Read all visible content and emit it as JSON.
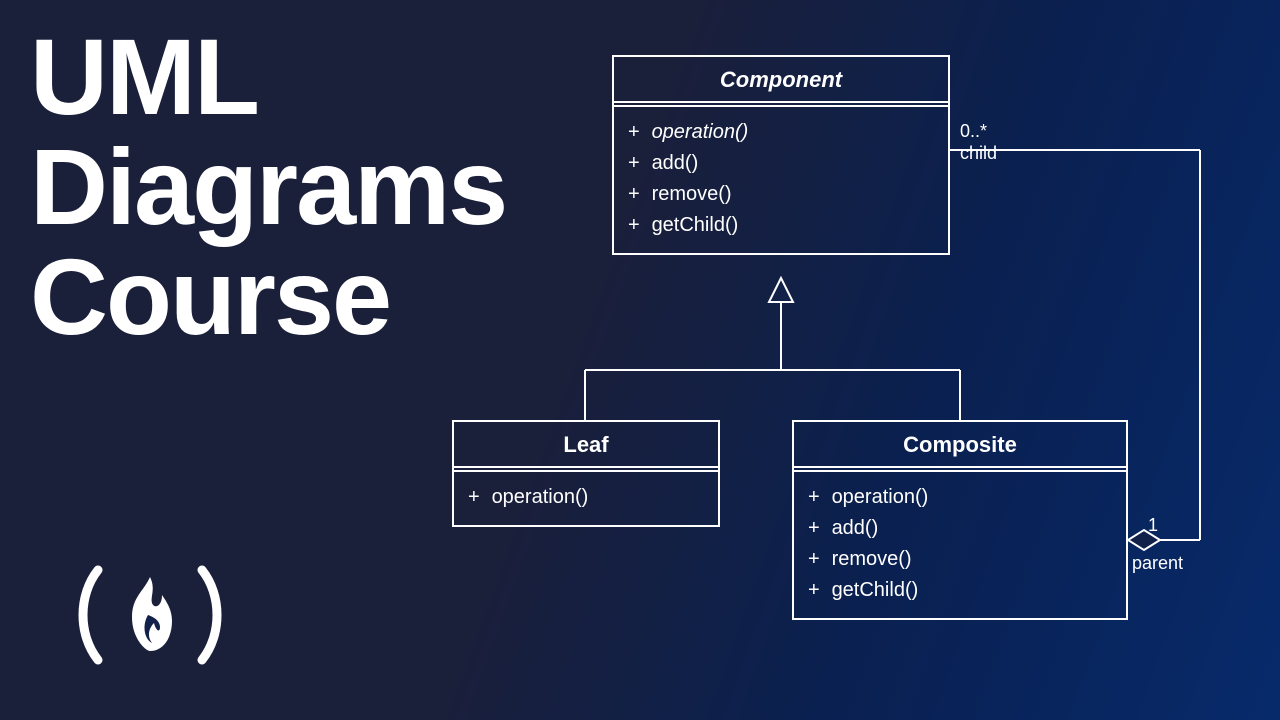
{
  "title": {
    "line1": "UML",
    "line2": "Diagrams",
    "line3": "Course"
  },
  "classes": {
    "component": {
      "name": "Component",
      "methods": [
        {
          "vis": "+",
          "sig": "operation()",
          "italic": true
        },
        {
          "vis": "+",
          "sig": "add()"
        },
        {
          "vis": "+",
          "sig": "remove()"
        },
        {
          "vis": "+",
          "sig": "getChild()"
        }
      ]
    },
    "leaf": {
      "name": "Leaf",
      "methods": [
        {
          "vis": "+",
          "sig": "operation()"
        }
      ]
    },
    "composite": {
      "name": "Composite",
      "methods": [
        {
          "vis": "+",
          "sig": "operation()"
        },
        {
          "vis": "+",
          "sig": "add()"
        },
        {
          "vis": "+",
          "sig": "remove()"
        },
        {
          "vis": "+",
          "sig": "getChild()"
        }
      ]
    }
  },
  "assoc": {
    "child_mult": "0..*",
    "child_role": "child",
    "parent_mult": "1",
    "parent_role": "parent"
  }
}
